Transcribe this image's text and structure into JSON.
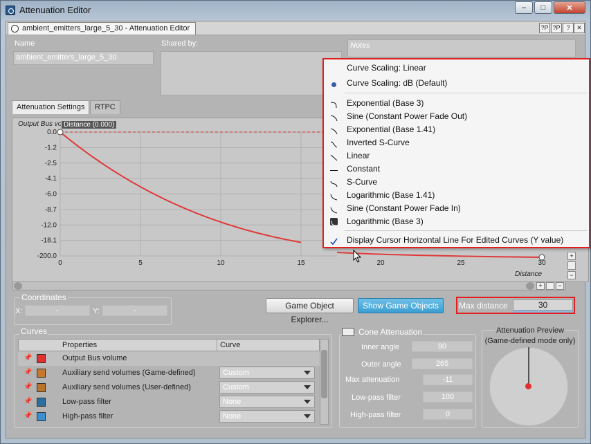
{
  "window": {
    "title": "Attenuation Editor",
    "buttons": [
      "–",
      "□",
      "✕"
    ]
  },
  "doc_tab": {
    "label": "ambient_emitters_large_5_30 - Attenuation Editor",
    "buttons": [
      "?P",
      "?P",
      "?",
      "✕"
    ]
  },
  "name": {
    "label": "Name",
    "value": "ambient_emitters_large_5_30"
  },
  "shared_by": {
    "label": "Shared by:"
  },
  "notes": {
    "placeholder": "Notes"
  },
  "tabs": [
    "Attenuation Settings",
    "RTPC"
  ],
  "graph": {
    "y_title": "Output Bus vo",
    "y_ticks": [
      "0.0",
      "-1.2",
      "-2.5",
      "-4.1",
      "-6.0",
      "-8.7",
      "-12.0",
      "-18.1",
      "-200.0"
    ],
    "x_ticks": [
      "0",
      "5",
      "10",
      "15",
      "20",
      "25",
      "30"
    ],
    "x_title": "Distance",
    "tooltip": "Distance (0.000)"
  },
  "chart_data": {
    "type": "line",
    "x": [
      0,
      30
    ],
    "xlabel": "Distance",
    "ylabel": "Output Bus vo",
    "series": [
      {
        "values_from": "0.0 at 0 to -200.0 at 30"
      }
    ]
  },
  "menu": {
    "items": [
      {
        "label": "Curve Scaling: Linear",
        "icon": ""
      },
      {
        "label": "Curve Scaling: dB (Default)",
        "icon": "radio-dot"
      },
      {
        "label": "Exponential (Base 3)",
        "icon": "curve-exp3"
      },
      {
        "label": "Sine (Constant Power Fade Out)",
        "icon": "curve-sine-out"
      },
      {
        "label": "Exponential (Base 1.41)",
        "icon": "curve-exp141"
      },
      {
        "label": "Inverted S-Curve",
        "icon": "curve-inv-s"
      },
      {
        "label": "Linear",
        "icon": "curve-linear"
      },
      {
        "label": "Constant",
        "icon": "curve-constant"
      },
      {
        "label": "S-Curve",
        "icon": "curve-s"
      },
      {
        "label": "Logarithmic (Base 1.41)",
        "icon": "curve-log141"
      },
      {
        "label": "Sine (Constant Power Fade In)",
        "icon": "curve-sine-in"
      },
      {
        "label": "Logarithmic (Base 3)",
        "icon": "curve-log3"
      },
      {
        "label": "Display Cursor Horizontal Line For Edited Curves (Y value)",
        "icon": "checkmark"
      }
    ]
  },
  "coordinates": {
    "label": "Coordinates",
    "x_label": "X:",
    "y_label": "Y:",
    "x_value": "-",
    "y_value": "-"
  },
  "buttons": {
    "explorer": "Game Object Explorer...",
    "show": "Show Game Objects"
  },
  "max_distance": {
    "label": "Max distance",
    "value": "30"
  },
  "curves": {
    "label": "Curves",
    "col_properties": "Properties",
    "col_curve": "Curve",
    "rows": [
      {
        "name": "Output Bus volume",
        "color": "#e03030",
        "curve": ""
      },
      {
        "name": "Auxiliary send volumes (Game-defined)",
        "color": "#c8782a",
        "curve": "Custom"
      },
      {
        "name": "Auxiliary send volumes (User-defined)",
        "color": "#b8742a",
        "curve": "Custom"
      },
      {
        "name": "Low-pass filter",
        "color": "#2a6fa0",
        "curve": "None"
      },
      {
        "name": "High-pass filter",
        "color": "#3a8fd0",
        "curve": "None"
      }
    ]
  },
  "cone": {
    "label": "Cone Attenuation",
    "inner_angle": {
      "label": "Inner angle",
      "value": "90"
    },
    "outer_angle": {
      "label": "Outer angle",
      "value": "265"
    },
    "max_att": {
      "label": "Max attenuation",
      "value": "-11"
    },
    "lowpass": {
      "label": "Low-pass filter",
      "value": "100"
    },
    "highpass": {
      "label": "High-pass filter",
      "value": "0"
    }
  },
  "preview": {
    "title": "Attenuation Preview",
    "subtitle": "(Game-defined mode only)"
  }
}
